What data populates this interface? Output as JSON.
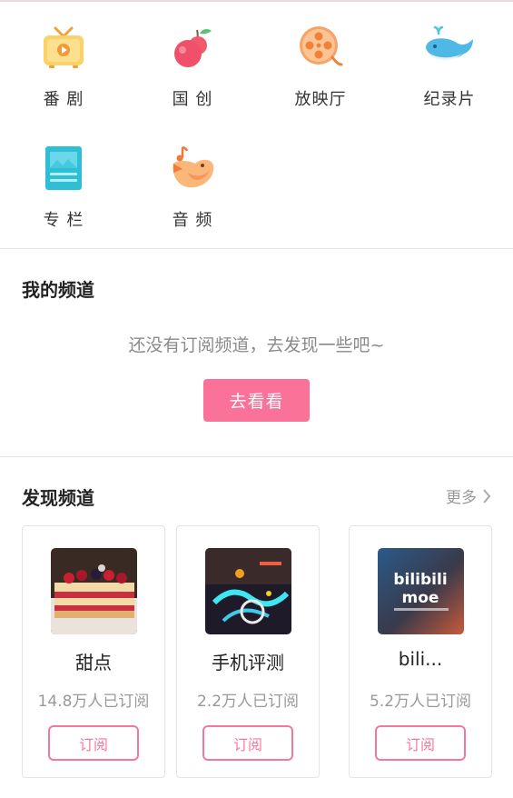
{
  "categories": [
    {
      "label": "番 剧",
      "icon": "tv-icon"
    },
    {
      "label": "国 创",
      "icon": "peach-icon"
    },
    {
      "label": "放映厅",
      "icon": "film-reel-icon"
    },
    {
      "label": "纪录片",
      "icon": "whale-icon"
    },
    {
      "label": "专 栏",
      "icon": "article-icon"
    },
    {
      "label": "音 频",
      "icon": "bird-music-icon"
    }
  ],
  "my_channels": {
    "title": "我的频道",
    "empty_text": "还没有订阅频道，去发现一些吧~",
    "button_label": "去看看"
  },
  "discover": {
    "title": "发现频道",
    "more_label": "更多",
    "cards": [
      {
        "name": "甜点",
        "subscribers": "14.8万人已订阅",
        "button": "订阅",
        "thumb": "dessert-thumbnail"
      },
      {
        "name": "手机评测",
        "subscribers": "2.2万人已订阅",
        "button": "订阅",
        "thumb": "phone-review-thumbnail"
      },
      {
        "name": "bili...",
        "subscribers": "5.2万人已订阅",
        "button": "订阅",
        "thumb": "bilibili-moe-thumbnail",
        "thumb_text": "bilibili",
        "thumb_text2": "moe"
      }
    ]
  },
  "colors": {
    "accent": "#fb7299"
  }
}
